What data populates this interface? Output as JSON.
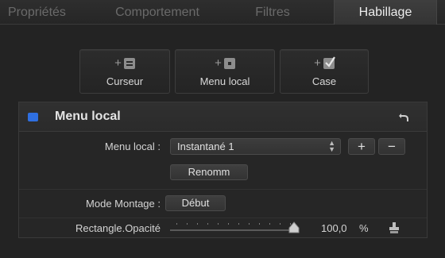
{
  "tabs": [
    {
      "label": "Propriétés"
    },
    {
      "label": "Comportement"
    },
    {
      "label": "Filtres"
    },
    {
      "label": "Habillage"
    }
  ],
  "add_buttons": [
    {
      "label": "Curseur",
      "icon": "slider-glyph-icon"
    },
    {
      "label": "Menu local",
      "icon": "popup-glyph-icon"
    },
    {
      "label": "Case",
      "icon": "checkbox-glyph-icon"
    }
  ],
  "panel": {
    "title": "Menu local",
    "chip_color": "#2f6fe0",
    "popup_row": {
      "label": "Menu local :",
      "value": "Instantané 1",
      "add_label": "+",
      "remove_label": "−",
      "rename_label": "Renomm"
    },
    "mode_row": {
      "label": "Mode Montage :",
      "button_label": "Début"
    },
    "opacity_row": {
      "label": "Rectangle.Opacité",
      "value": "100,0",
      "unit": "%",
      "level_percent": 100
    }
  }
}
